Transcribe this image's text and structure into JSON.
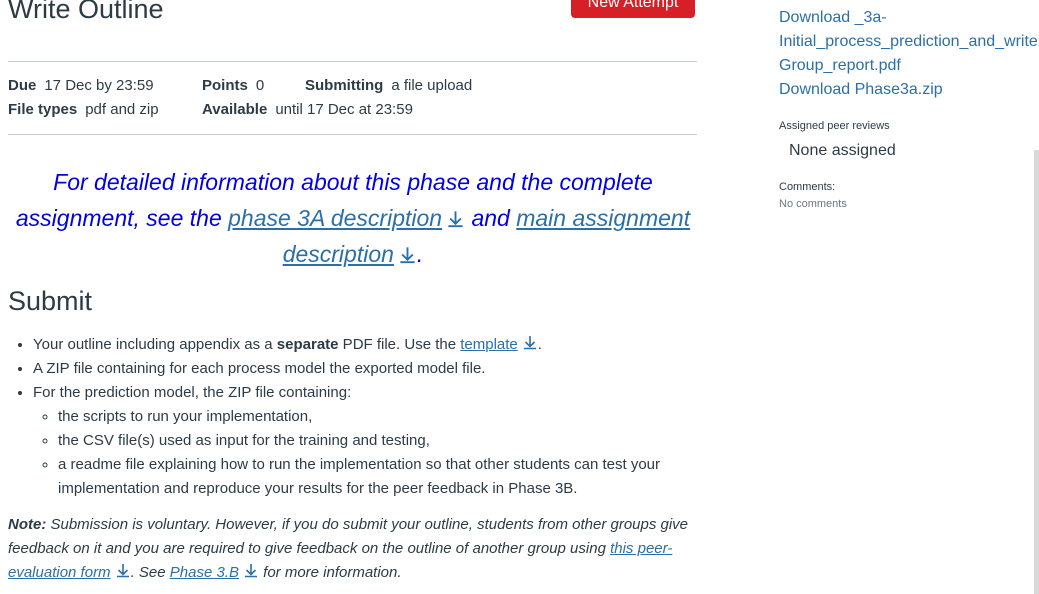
{
  "page": {
    "title": "Write Outline",
    "new_attempt_label": "New Attempt"
  },
  "details": {
    "due_label": "Due",
    "due_value": "17 Dec by 23:59",
    "points_label": "Points",
    "points_value": "0",
    "submitting_label": "Submitting",
    "submitting_value": "a file upload",
    "file_types_label": "File types",
    "file_types_value": "pdf and zip",
    "available_label": "Available",
    "available_value": "until 17 Dec at 23:59"
  },
  "intro": {
    "text_1": "For detailed information about this phase and the complete assignment, see the ",
    "link_1": "phase 3A description",
    "text_2": " and ",
    "link_2": "main assignment description",
    "text_3": "."
  },
  "submit": {
    "heading": "Submit",
    "item_1_a": "Your outline including appendix as a ",
    "item_1_bold": "separate",
    "item_1_b": " PDF file. Use the ",
    "item_1_link": "template",
    "item_1_c": ".",
    "item_2": "A ZIP file containing for each process model the exported model file.",
    "item_3": "For the prediction model, the ZIP file containing:",
    "sub_items": [
      "the scripts to run your implementation,",
      "the CSV file(s) used as input for the training and testing,",
      "a readme file explaining how to run the implementation so that other students can test your implementation and reproduce your results for the peer feedback in Phase 3B."
    ]
  },
  "note": {
    "label": "Note:",
    "text_1": " Submission is voluntary. However, if you do submit your outline, students from other groups give feedback on it and you are required to give feedback on the outline of another group using ",
    "link_1": "this peer-evaluation form",
    "text_2": ". See ",
    "link_2": "Phase 3.B",
    "text_3": " for more information."
  },
  "sidebar": {
    "download_1_line1": "Download _3a-",
    "download_1_line2": "Initial_process_prediction_and_write",
    "download_1_line3": "Group_report.pdf",
    "download_2": "Download Phase3a.zip",
    "peer_reviews_heading": "Assigned peer reviews",
    "peer_reviews_value": "None assigned",
    "comments_heading": "Comments:",
    "comments_value": "No comments"
  },
  "colors": {
    "accent_button": "#d61f26",
    "link": "#2b6fa8",
    "intro_text": "#0000e0",
    "text": "#2d3b45"
  }
}
